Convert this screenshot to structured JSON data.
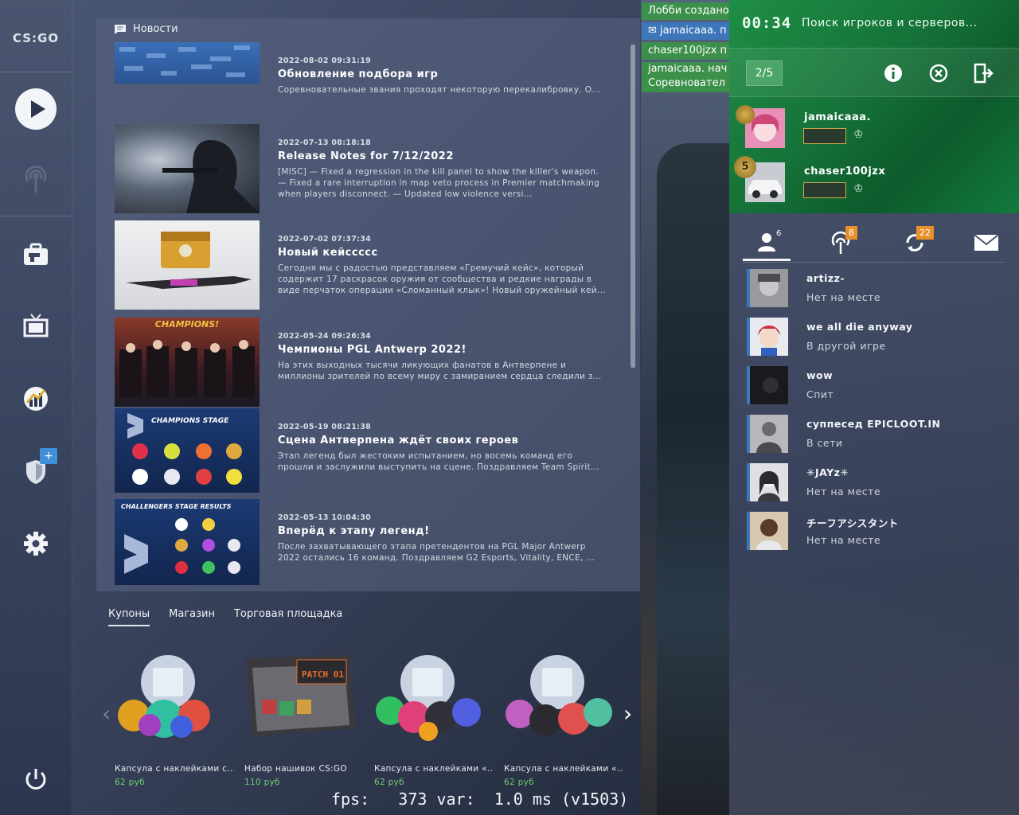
{
  "logo_text": "CS:GO",
  "news": {
    "header": "Новости",
    "items": [
      {
        "date": "2022-08-02 09:31:19",
        "title": "Обновление подбора игр",
        "desc": "Соревновательные звания проходят некоторую перекалибровку. О..."
      },
      {
        "date": "2022-07-13 08:18:18",
        "title": "Release Notes for 7/12/2022",
        "desc": "[MISC] — Fixed a regression in the kill panel to show the killer's weapon. — Fixed a rare interruption in map veto process in Premier matchmaking when players disconnect. — Updated low violence versi..."
      },
      {
        "date": "2022-07-02 07:37:34",
        "title": "Новый кейсcccc",
        "desc": "Сегодня мы с радостью представляем «Гремучий кейс», который содержит 17 раскрасок оружия от сообщества и редкие награды в виде перчаток операции «Сломанный клык»! Новый оружейный кей..."
      },
      {
        "date": "2022-05-24 09:26:34",
        "title": "Чемпионы PGL Antwerp 2022!",
        "desc": "На этих выходных тысячи ликующих фанатов в Антверпене и миллионы зрителей по всему миру с замиранием сердца следили з..."
      },
      {
        "date": "2022-05-19 08:21:38",
        "title": "Сцена Антверпена ждёт своих героев",
        "desc": "Этап легенд был жестоким испытанием, но восемь команд его прошли и заслужили выступить на сцене. Поздравляем Team Spirit..."
      },
      {
        "date": "2022-05-13 10:04:30",
        "title": "Вперёд к этапу легенд!",
        "desc": "После захватывающего этапа претендентов на PGL Major Antwerp 2022 остались 16 команд. Поздравляем G2 Esports, Vitality, ENCE, ..."
      }
    ],
    "thumb_captions": {
      "champions": "CHAMPIONS!",
      "champions_stage": "CHAMPIONS STAGE",
      "challengers": "CHALLENGERS STAGE RESULTS"
    }
  },
  "store": {
    "tabs": [
      "Купоны",
      "Магазин",
      "Торговая площадка"
    ],
    "items": [
      {
        "name": "Капсула с наклейками с...",
        "price": "62 руб"
      },
      {
        "name": "Набор нашивок CS:GO",
        "price": "110 руб"
      },
      {
        "name": "Капсула с наклейками «...",
        "price": "62 руб"
      },
      {
        "name": "Капсула с наклейками «...",
        "price": "62 руб"
      }
    ],
    "patch_label": "PATCH 01"
  },
  "lobby_notes": [
    "Лобби создано",
    "jamaicaaa. п",
    "chaser100jzx п",
    "jamaicaaa. нач Соревноватeл"
  ],
  "matchmaking": {
    "timer": "00:34",
    "status": "Поиск игроков и серверов...",
    "party_count": "2/5",
    "members": [
      {
        "name": "jamaicaaa.",
        "rank": ""
      },
      {
        "name": "chaser100jzx",
        "rank": "5"
      }
    ]
  },
  "friends": {
    "tabs": [
      {
        "icon": "friends-icon",
        "count": "6"
      },
      {
        "icon": "broadcast-icon",
        "count": "8"
      },
      {
        "icon": "refresh-icon",
        "count": "22"
      },
      {
        "icon": "mail-icon",
        "count": ""
      }
    ],
    "list": [
      {
        "name": "artizz-",
        "status": "Нет на месте"
      },
      {
        "name": "we all die anyway",
        "status": "В другой игре"
      },
      {
        "name": "wow",
        "status": "Спит"
      },
      {
        "name": "суппесед EPICLOOT.IN",
        "status": "В сети"
      },
      {
        "name": "✳JAYz✳",
        "status": "Нет на месте"
      },
      {
        "name": "チーフアシスタント",
        "status": "Нет на месте"
      }
    ]
  },
  "fps_text": "fps:   373 var:  1.0 ms (v1503)"
}
